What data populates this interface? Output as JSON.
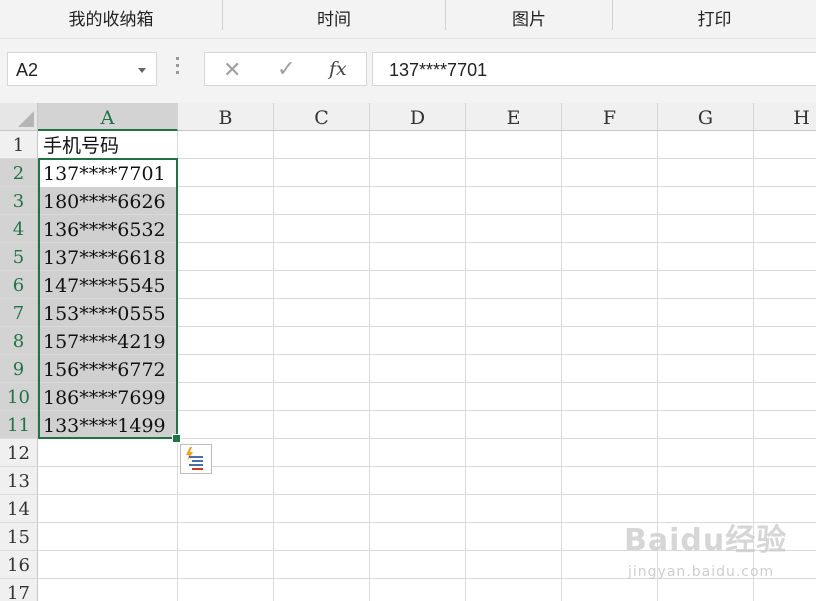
{
  "menubar": {
    "items": [
      "我的收纳箱",
      "时间",
      "图片",
      "打印"
    ]
  },
  "formula_bar": {
    "name_box": "A2",
    "cancel_icon": "close-icon",
    "enter_icon": "check-icon",
    "function_label": "fx",
    "content": "137****7701"
  },
  "sheet": {
    "columns": [
      "A",
      "B",
      "C",
      "D",
      "E",
      "F",
      "G",
      "H"
    ],
    "rows": [
      "1",
      "2",
      "3",
      "4",
      "5",
      "6",
      "7",
      "8",
      "9",
      "10",
      "11",
      "12",
      "13",
      "14",
      "15",
      "16",
      "17"
    ],
    "column_a_values": [
      "手机号码",
      "137****7701",
      "180****6626",
      "136****6532",
      "137****6618",
      "147****5545",
      "153****0555",
      "157****4219",
      "156****6772",
      "186****7699",
      "133****1499"
    ],
    "selected_column": "A",
    "selected_rows": [
      "2",
      "3",
      "4",
      "5",
      "6",
      "7",
      "8",
      "9",
      "10",
      "11"
    ],
    "active_cell": "A2",
    "quick_analysis_icon": "quick-analysis-icon"
  },
  "watermark": {
    "logo": "Baidu经验",
    "url": "jingyan.baidu.com"
  },
  "colors": {
    "accent": "#217346",
    "selection_fill": "#d0d0d0",
    "header_bg": "#f0f0f0"
  }
}
